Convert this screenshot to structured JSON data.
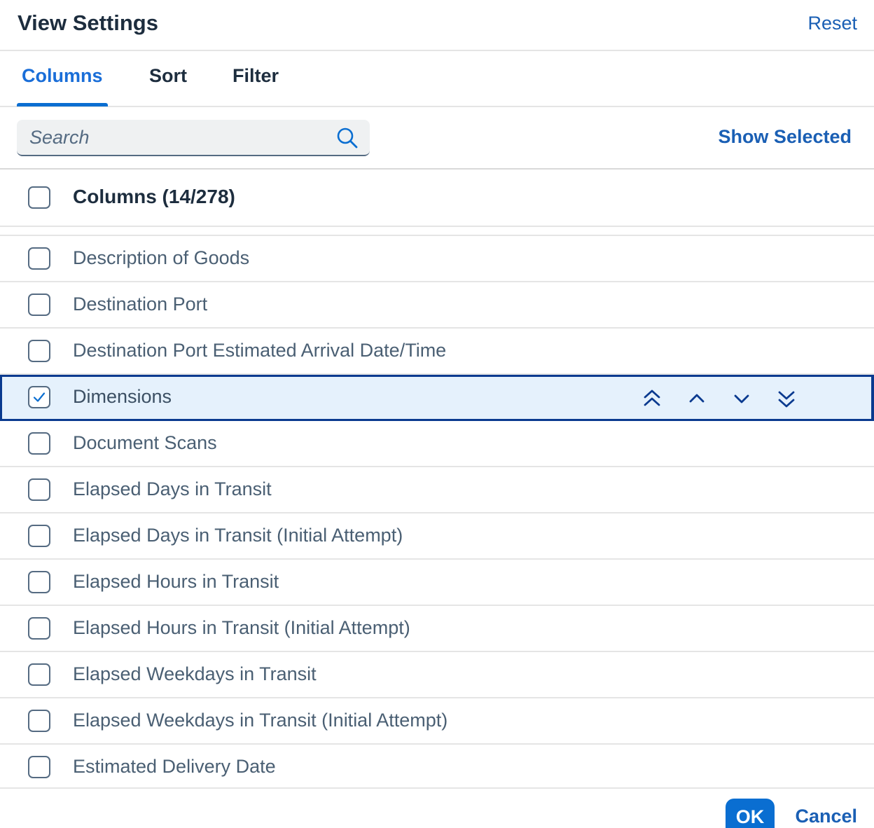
{
  "dialog": {
    "title": "View Settings",
    "reset_label": "Reset"
  },
  "tabs": [
    {
      "label": "Columns",
      "active": true
    },
    {
      "label": "Sort",
      "active": false
    },
    {
      "label": "Filter",
      "active": false
    }
  ],
  "toolbar": {
    "search_placeholder": "Search",
    "search_value": "",
    "show_selected_label": "Show Selected"
  },
  "list_header": {
    "label": "Columns (14/278)",
    "checked": false
  },
  "rows": [
    {
      "label": "Description of Goods",
      "checked": false,
      "selected": false
    },
    {
      "label": "Destination Port",
      "checked": false,
      "selected": false
    },
    {
      "label": "Destination Port Estimated Arrival Date/Time",
      "checked": false,
      "selected": false
    },
    {
      "label": "Dimensions",
      "checked": true,
      "selected": true
    },
    {
      "label": "Document Scans",
      "checked": false,
      "selected": false
    },
    {
      "label": "Elapsed Days in Transit",
      "checked": false,
      "selected": false
    },
    {
      "label": "Elapsed Days in Transit (Initial Attempt)",
      "checked": false,
      "selected": false
    },
    {
      "label": "Elapsed Hours in Transit",
      "checked": false,
      "selected": false
    },
    {
      "label": "Elapsed Hours in Transit (Initial Attempt)",
      "checked": false,
      "selected": false
    },
    {
      "label": "Elapsed Weekdays in Transit",
      "checked": false,
      "selected": false
    },
    {
      "label": "Elapsed Weekdays in Transit (Initial Attempt)",
      "checked": false,
      "selected": false
    },
    {
      "label": "Estimated Delivery Date",
      "checked": false,
      "selected": false
    }
  ],
  "move_controls": [
    {
      "icon": "double-chevron-up-icon",
      "name": "move-to-top-button"
    },
    {
      "icon": "chevron-up-icon",
      "name": "move-up-button"
    },
    {
      "icon": "chevron-down-icon",
      "name": "move-down-button"
    },
    {
      "icon": "double-chevron-down-icon",
      "name": "move-to-bottom-button"
    }
  ],
  "footer": {
    "ok_label": "OK",
    "cancel_label": "Cancel"
  },
  "colors": {
    "accent": "#0a6ed1",
    "link": "#1a5fb4",
    "selected_row_bg": "#e5f1fc",
    "selected_row_border": "#0a3a8f"
  }
}
